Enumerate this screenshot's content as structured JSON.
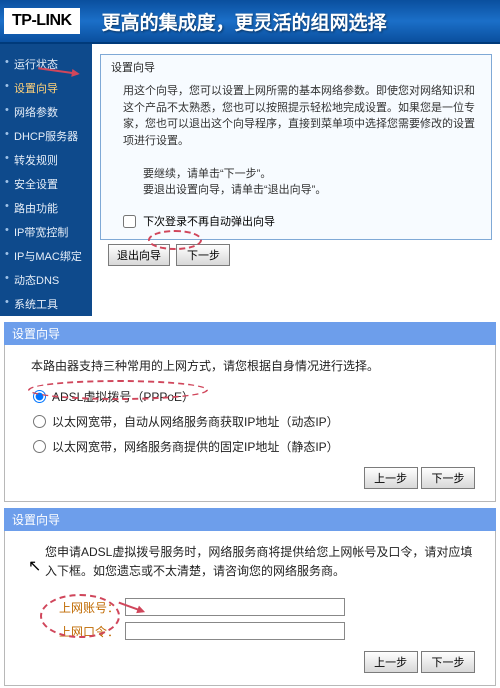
{
  "header": {
    "logo": "TP-LINK",
    "tagline": "更高的集成度，更灵活的组网选择"
  },
  "sidebar": {
    "items": [
      {
        "label": "运行状态"
      },
      {
        "label": "设置向导",
        "hi": true
      },
      {
        "label": "网络参数"
      },
      {
        "label": "DHCP服务器"
      },
      {
        "label": "转发规则"
      },
      {
        "label": "安全设置"
      },
      {
        "label": "路由功能"
      },
      {
        "label": "IP带宽控制"
      },
      {
        "label": "IP与MAC绑定"
      },
      {
        "label": "动态DNS"
      },
      {
        "label": "系统工具"
      }
    ]
  },
  "wizard1": {
    "title": "设置向导",
    "body": "用这个向导，您可以设置上网所需的基本网络参数。即使您对网络知识和这个产品不太熟悉，您也可以按照提示轻松地完成设置。如果您是一位专家，您也可以退出这个向导程序，直接到菜单项中选择您需要修改的设置项进行设置。",
    "cont": "要继续，请单击“下一步”。",
    "exit": "要退出设置向导，请单击“退出向导”。",
    "checkbox": "下次登录不再自动弹出向导",
    "btn_exit": "退出向导",
    "btn_next": "下一步"
  },
  "panel2": {
    "title": "设置向导",
    "desc": "本路由器支持三种常用的上网方式，请您根据自身情况进行选择。",
    "opts": [
      "ADSL虚拟拨号（PPPoE）",
      "以太网宽带，自动从网络服务商获取IP地址（动态IP）",
      "以太网宽带，网络服务商提供的固定IP地址（静态IP）"
    ],
    "btn_prev": "上一步",
    "btn_next": "下一步"
  },
  "panel3": {
    "title": "设置向导",
    "desc": "您申请ADSL虚拟拨号服务时，网络服务商将提供给您上网帐号及口令，请对应填入下框。如您遗忘或不太清楚，请咨询您的网络服务商。",
    "f1": "上网账号：",
    "f2": "上网口令：",
    "btn_prev": "上一步",
    "btn_next": "下一步"
  }
}
